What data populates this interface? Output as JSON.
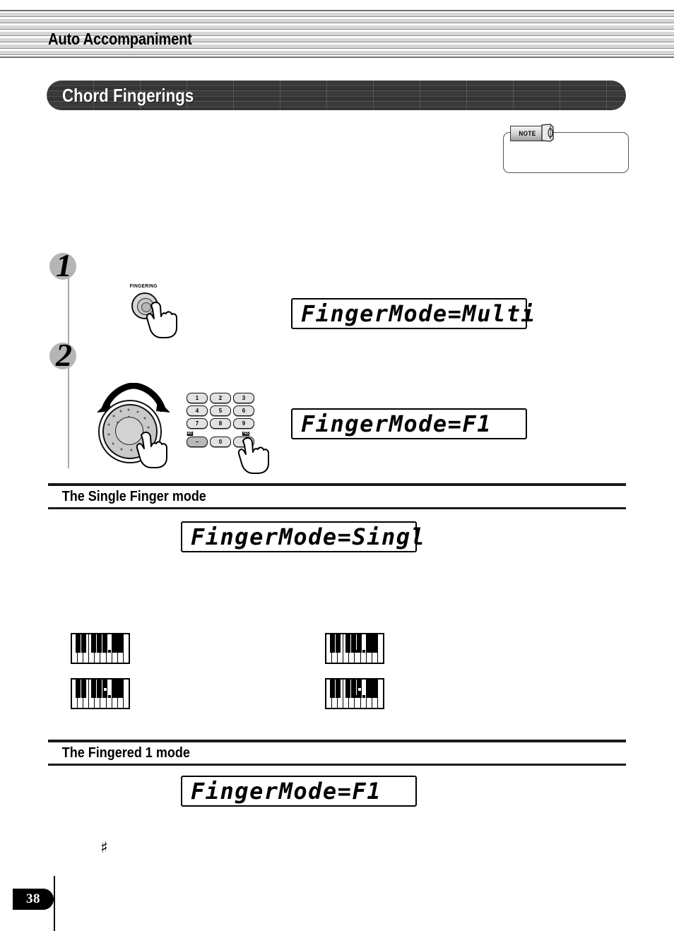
{
  "page": {
    "number": "38",
    "running_head": "Auto Accompaniment",
    "chapter_title": "Chord Fingerings",
    "footnote_symbol": "♯"
  },
  "note_callout": {
    "tab_label": "NOTE",
    "body": ""
  },
  "steps": [
    {
      "number": "1",
      "control_label": "FINGERING",
      "lcd": "FingerMode=Multi"
    },
    {
      "number": "2",
      "lcd": "FingerMode=F1"
    }
  ],
  "keypad": {
    "rows": [
      [
        "1",
        "2",
        "3"
      ],
      [
        "4",
        "5",
        "6"
      ],
      [
        "7",
        "8",
        "9"
      ],
      [
        "–",
        "0",
        "+"
      ]
    ],
    "minus_label": "NO",
    "plus_label": "YES"
  },
  "sections": [
    {
      "title": "The Single Finger mode",
      "lcd": "FingerMode=Singl"
    },
    {
      "title": "The Fingered 1 mode",
      "lcd": "FingerMode=F1"
    }
  ],
  "keyboard_diagrams": [
    {
      "id": "kbd-1",
      "label": ""
    },
    {
      "id": "kbd-2",
      "label": ""
    },
    {
      "id": "kbd-3",
      "label": ""
    },
    {
      "id": "kbd-4",
      "label": ""
    }
  ],
  "colors": {
    "title_bar": "#3a3a3a",
    "step_badge": "#b5b5b5",
    "rule": "#1a1a1a",
    "page_tab": "#000000"
  }
}
